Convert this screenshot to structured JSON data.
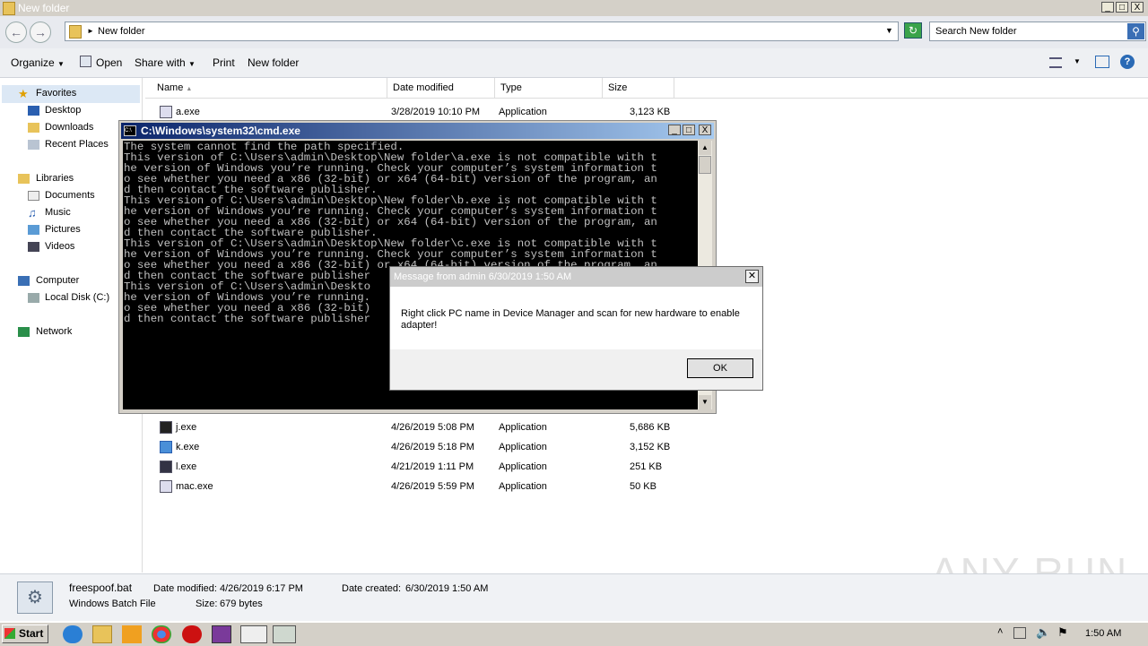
{
  "window": {
    "title": "New folder",
    "buttons": [
      "_",
      "□",
      "X"
    ]
  },
  "address": {
    "path": "New folder",
    "search_placeholder": "Search New folder"
  },
  "toolbar": {
    "organize": "Organize",
    "open": "Open",
    "share_with": "Share with",
    "print": "Print",
    "new_folder": "New folder"
  },
  "nav": {
    "favorites": "Favorites",
    "desktop": "Desktop",
    "downloads": "Downloads",
    "recent_places": "Recent Places",
    "libraries": "Libraries",
    "documents": "Documents",
    "music": "Music",
    "pictures": "Pictures",
    "videos": "Videos",
    "computer": "Computer",
    "local_disk": "Local Disk (C:)",
    "network": "Network"
  },
  "columns": {
    "name": "Name",
    "date": "Date modified",
    "type": "Type",
    "size": "Size"
  },
  "files": [
    {
      "name": "a.exe",
      "date": "3/28/2019 10:10 PM",
      "type": "Application",
      "size": "3,123 KB"
    },
    {
      "name": "j.exe",
      "date": "4/26/2019 5:08 PM",
      "type": "Application",
      "size": "5,686 KB"
    },
    {
      "name": "k.exe",
      "date": "4/26/2019 5:18 PM",
      "type": "Application",
      "size": "3,152 KB"
    },
    {
      "name": "l.exe",
      "date": "4/21/2019 1:11 PM",
      "type": "Application",
      "size": "251 KB"
    },
    {
      "name": "mac.exe",
      "date": "4/26/2019 5:59 PM",
      "type": "Application",
      "size": "50 KB"
    }
  ],
  "cmd": {
    "title": "C:\\Windows\\system32\\cmd.exe",
    "lines": [
      "The system cannot find the path specified.",
      "This version of C:\\Users\\admin\\Desktop\\New folder\\a.exe is not compatible with t",
      "he version of Windows you’re running. Check your computer’s system information t",
      "o see whether you need a x86 (32-bit) or x64 (64-bit) version of the program, an",
      "d then contact the software publisher.",
      "This version of C:\\Users\\admin\\Desktop\\New folder\\b.exe is not compatible with t",
      "he version of Windows you’re running. Check your computer’s system information t",
      "o see whether you need a x86 (32-bit) or x64 (64-bit) version of the program, an",
      "d then contact the software publisher.",
      "This version of C:\\Users\\admin\\Desktop\\New folder\\c.exe is not compatible with t",
      "he version of Windows you’re running. Check your computer’s system information t",
      "o see whether you need a x86 (32-bit) or x64 (64-bit) version of the program, an",
      "d then contact the software publisher",
      "This version of C:\\Users\\admin\\Deskto",
      "he version of Windows you’re running.",
      "o see whether you need a x86 (32-bit)",
      "d then contact the software publisher"
    ]
  },
  "message": {
    "title": "Message from admin 6/30/2019 1:50 AM",
    "text_line1": "Right click PC name in Device Manager and scan for new hardware to enable",
    "text_line2": "adapter!",
    "ok": "OK"
  },
  "details": {
    "filename": "freespoof.bat",
    "filetype": "Windows Batch File",
    "modified_label": "Date modified:",
    "modified_value": "4/26/2019 6:17 PM",
    "size_label": "Size:",
    "size_value": "679 bytes",
    "created_label": "Date created:",
    "created_value": "6/30/2019 1:50 AM"
  },
  "taskbar": {
    "start": "Start",
    "clock": "1:50 AM"
  },
  "watermark": "ANY RUN"
}
